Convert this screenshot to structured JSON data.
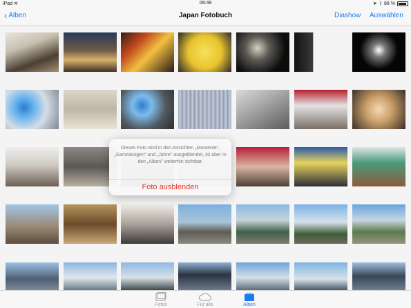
{
  "status": {
    "carrier": "iPad",
    "time": "09:49",
    "battery": "88 %"
  },
  "nav": {
    "back_label": "Alben",
    "title": "Japan Fotobuch",
    "action_slideshow": "Diashow",
    "action_select": "Auswählen"
  },
  "popover": {
    "message": "Dieses Foto wird in den Ansichten „Momente\", „Sammlungen\" und „Jahre\" ausgeblendet, ist aber in den „Alben\" weiterhin sichtbar.",
    "action_label": "Foto ausblenden"
  },
  "tabs": [
    {
      "label": "Fotos",
      "icon": "photos-icon",
      "active": false
    },
    {
      "label": "Für alle",
      "icon": "cloud-icon",
      "active": false
    },
    {
      "label": "Alben",
      "icon": "albums-icon",
      "active": true
    }
  ],
  "colors": {
    "accent": "#1a7cf3",
    "destructive": "#e5352b"
  }
}
